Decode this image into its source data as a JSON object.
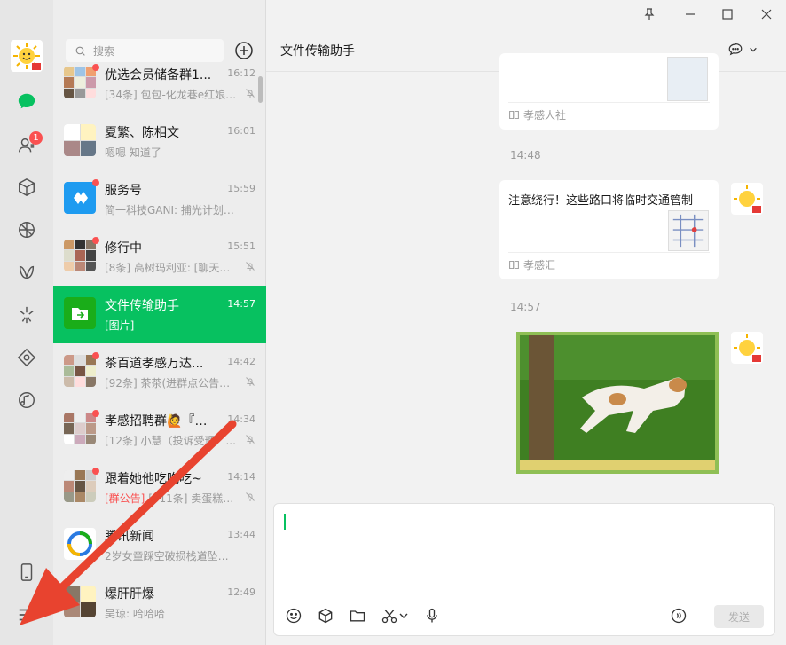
{
  "window": {
    "controls": [
      "pin-icon",
      "minimize-icon",
      "maximize-icon",
      "close-icon"
    ]
  },
  "rail": {
    "contacts_badge": "1"
  },
  "search": {
    "placeholder": "搜索"
  },
  "conversations": [
    {
      "name": "优选会员储备群1...",
      "time": "16:12",
      "preview": "[34条] 包包-化龙巷e红娘: [...",
      "muted": true,
      "unread_dot": true
    },
    {
      "name": "夏繁、陈相文",
      "time": "16:01",
      "preview": "嗯嗯 知道了",
      "muted": false,
      "unread_dot": false
    },
    {
      "name": "服务号",
      "time": "15:59",
      "preview": "简一科技GANI: 捕光计划第二...",
      "muted": false,
      "unread_dot": true
    },
    {
      "name": "修行中",
      "time": "15:51",
      "preview": "[8条] 高树玛利亚: [聊天记...",
      "muted": true,
      "unread_dot": true
    },
    {
      "name": "文件传输助手",
      "time": "14:57",
      "preview": "[图片]",
      "muted": false,
      "unread_dot": false
    },
    {
      "name": "茶百道孝感万达...",
      "time": "14:42",
      "preview": "[92条] 茶茶(进群点公告领...",
      "muted": true,
      "unread_dot": true
    },
    {
      "name": "孝感招聘群🙋『掌...",
      "time": "14:34",
      "preview": "[12条] 小慧（投诉受理）...",
      "muted": true,
      "unread_dot": true
    },
    {
      "name": "跟着她他吃吃吃~",
      "time": "14:14",
      "preview": "[群公告] [511条] 卖蛋糕的...",
      "preview_highlight": "[群公告]",
      "muted": true,
      "unread_dot": true
    },
    {
      "name": "腾讯新闻",
      "time": "13:44",
      "preview": "2岁女童踩空破损栈道坠江,...",
      "muted": false,
      "unread_dot": false
    },
    {
      "name": "爆肝肝爆",
      "time": "12:49",
      "preview": "吴琼: 哈哈哈",
      "muted": false,
      "unread_dot": false
    }
  ],
  "chat": {
    "title": "文件传输助手",
    "messages": [
      {
        "type": "card",
        "title": "",
        "source": "孝感人社"
      },
      {
        "type": "time",
        "text": "14:48"
      },
      {
        "type": "card",
        "title": "注意绕行！这些路口将临时交通管制",
        "source": "孝感汇"
      },
      {
        "type": "time",
        "text": "14:57"
      },
      {
        "type": "image",
        "desc": "dog"
      }
    ],
    "send_label": "发送"
  }
}
